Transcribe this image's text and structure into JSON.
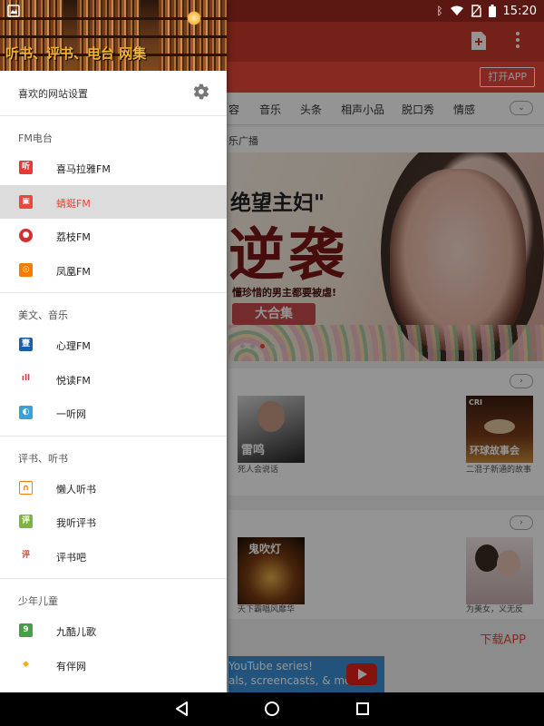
{
  "status_bar": {
    "time": "15:20"
  },
  "background_app": {
    "open_app_label": "打开APP",
    "categories": [
      "容",
      "音乐",
      "头条",
      "相声小品",
      "脱口秀",
      "情感"
    ],
    "section_label": "乐广播",
    "banner": {
      "title_line1": "绝望主妇\"",
      "title_line2": "逆袭",
      "subtitle": "懂珍惜的男主都要被虐!",
      "pill": "大合集"
    },
    "row1": [
      {
        "caption": "死人会说话",
        "overlay": "雷鸣"
      },
      {
        "caption": "二混子新通的故事",
        "overlay": "环球故事会"
      }
    ],
    "row2": [
      {
        "caption": "天下霸唱风靡华",
        "overlay": "鬼吹灯"
      },
      {
        "caption": "为美女，义无反",
        "overlay": ""
      }
    ],
    "download_label": "下载APP",
    "ad": {
      "line1": "YouTube series!",
      "line2": "als, screencasts, & more."
    }
  },
  "drawer": {
    "header_text": "听书、评书、电台 网集",
    "settings_label": "喜欢的网站设置",
    "groups": [
      {
        "title": "FM电台",
        "items": [
          {
            "label": "喜马拉雅FM",
            "icon": "ximalaya-icon",
            "color": "#e53935",
            "glyph": "听"
          },
          {
            "label": "蜻蜓FM",
            "icon": "qingting-icon",
            "color": "#e8483a",
            "glyph": "▣",
            "active": true
          },
          {
            "label": "荔枝FM",
            "icon": "lizhi-icon",
            "color": "#d32f2f",
            "glyph": "●"
          },
          {
            "label": "凤凰FM",
            "icon": "fenghuang-icon",
            "color": "#f57c00",
            "glyph": "◎"
          }
        ]
      },
      {
        "title": "美文、音乐",
        "items": [
          {
            "label": "心理FM",
            "icon": "xinli-icon",
            "color": "#1e5ea8",
            "glyph": "壹"
          },
          {
            "label": "悦读FM",
            "icon": "yuedu-icon",
            "color": "#e53935",
            "glyph": "ıll"
          },
          {
            "label": "一听网",
            "icon": "yiting-icon",
            "color": "#3aa0d8",
            "glyph": "◐"
          }
        ]
      },
      {
        "title": "评书、听书",
        "items": [
          {
            "label": "懒人听书",
            "icon": "lanren-icon",
            "color": "#f57c00",
            "glyph": "∩"
          },
          {
            "label": "我听评书",
            "icon": "woting-icon",
            "color": "#7cb342",
            "glyph": "评"
          },
          {
            "label": "评书吧",
            "icon": "pingshuba-icon",
            "color": "#e53935",
            "glyph": "评"
          }
        ]
      },
      {
        "title": "少年儿童",
        "items": [
          {
            "label": "九酷儿歌",
            "icon": "jiuku-icon",
            "color": "#43a047",
            "glyph": "9"
          },
          {
            "label": "有伴网",
            "icon": "youban-icon",
            "color": "#f9a825",
            "glyph": "◆"
          }
        ]
      }
    ]
  },
  "colors": {
    "accent": "#e8483a",
    "toolbar": "#c9392c",
    "active_row": "#dcdcdc"
  }
}
